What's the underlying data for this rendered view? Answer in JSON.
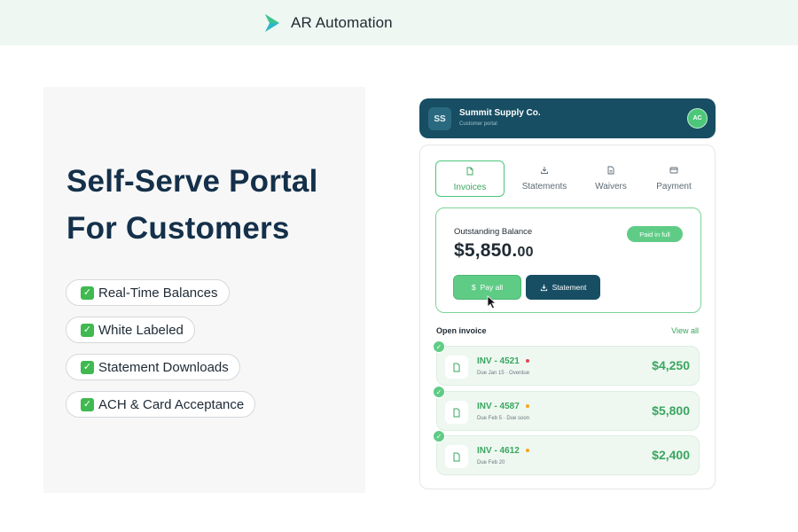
{
  "brand": {
    "name": "AR Automation"
  },
  "hero": {
    "headline_line1": "Self-Serve Portal",
    "headline_line2": "For Customers",
    "features": [
      {
        "label": "Real-Time Balances"
      },
      {
        "label": "White Labeled"
      },
      {
        "label": "Statement Downloads"
      },
      {
        "label": "ACH & Card Acceptance"
      }
    ]
  },
  "portal": {
    "header": {
      "initials": "SS",
      "company": "Summit Supply Co.",
      "subtitle": "Customer portal",
      "user_initials": "AC"
    },
    "tabs": [
      {
        "label": "Invoices",
        "icon": "document-icon",
        "active": true
      },
      {
        "label": "Statements",
        "icon": "download-icon",
        "active": false
      },
      {
        "label": "Waivers",
        "icon": "file-icon",
        "active": false
      },
      {
        "label": "Payment",
        "icon": "card-icon",
        "active": false
      }
    ],
    "balance": {
      "label": "Outstanding Balance",
      "amount_main": "$5,850.",
      "amount_cents": "00",
      "badge": "Paid in full",
      "pay_label": "Pay all",
      "statement_label": "Statement"
    },
    "open_invoice": {
      "title": "Open invoice",
      "view_all": "View all",
      "items": [
        {
          "number": "INV - 4521",
          "due": "Due Jan 15 · Overdue",
          "amount": "$4,250",
          "status_color": "#e5484d"
        },
        {
          "number": "INV - 4587",
          "due": "Due Feb 5 · Due soon",
          "amount": "$5,800",
          "status_color": "#f5a524"
        },
        {
          "number": "INV - 4612",
          "due": "Due Feb 20",
          "amount": "$2,400",
          "status_color": "#f5a524"
        }
      ]
    }
  },
  "colors": {
    "accent_green": "#5fcc86",
    "navy": "#174e63",
    "headline": "#14304a"
  }
}
